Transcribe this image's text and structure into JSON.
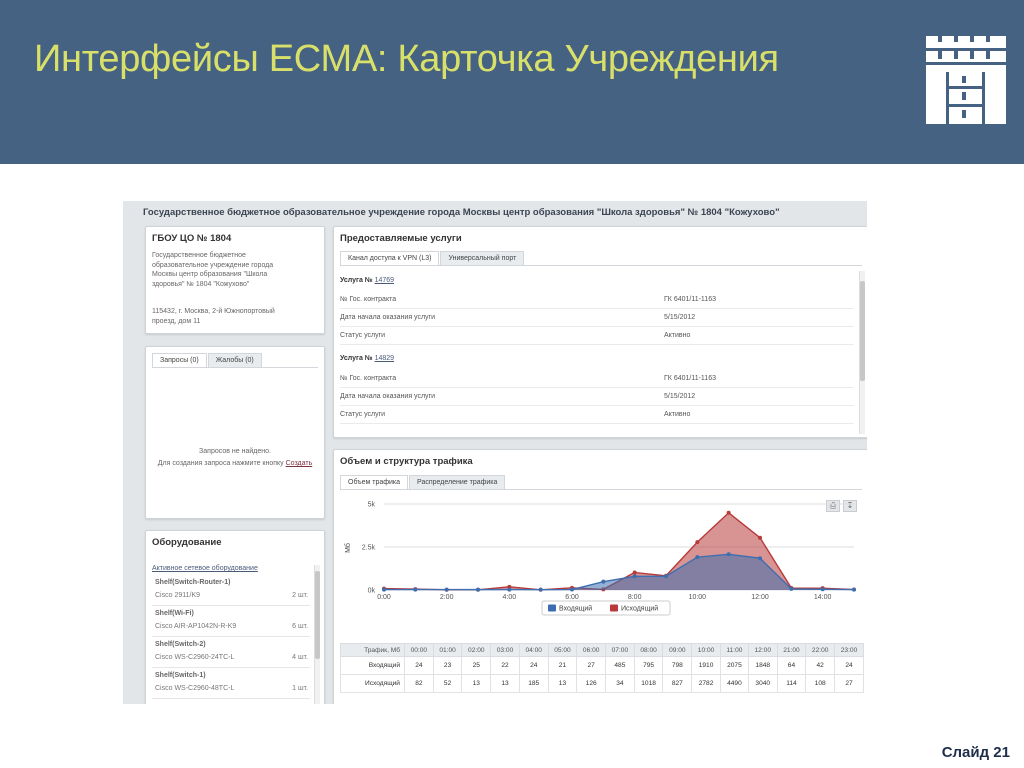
{
  "slide": {
    "title": "Интерфейсы ЕСМА: Карточка Учреждения",
    "number": "Слайд 21"
  },
  "colors": {
    "header_bg": "#466283",
    "title_color": "#d9e06a",
    "incoming": "#3d6fb0",
    "outgoing": "#b83a3a"
  },
  "screen": {
    "title": "Государственное бюджетное образовательное учреждение города Москвы центр образования \"Школа здоровья\" № 1804 \"Кожухово\""
  },
  "org": {
    "short_name": "ГБОУ ЦО № 1804",
    "full_name_lines": [
      "Государственное бюджетное",
      "образовательное учреждение города",
      "Москвы центр образования \"Школа",
      "здоровья\" № 1804 \"Кожухово\""
    ],
    "address_lines": [
      "115432, г. Москва, 2-й Южнопортовый",
      "проезд, дом 11"
    ]
  },
  "requests": {
    "tabs": [
      "Запросы (0)",
      "Жалобы (0)"
    ],
    "empty_text": "Запросов не найдено.",
    "hint_text": "Для создания запроса нажмите кнопку",
    "create_link": "Создать"
  },
  "equipment": {
    "title": "Оборудование",
    "section_link": "Активное сетевое оборудование",
    "items": [
      {
        "name": "Shelf(Switch-Router-1)",
        "model": "Cisco 2911/K9",
        "count": "2 шт."
      },
      {
        "name": "Shelf(Wi-Fi)",
        "model": "Cisco AIR-AP1042N-R-K9",
        "count": "6 шт."
      },
      {
        "name": "Shelf(Switch-2)",
        "model": "Cisco WS-C2960-24TC-L",
        "count": "4 шт."
      },
      {
        "name": "Shelf(Switch-1)",
        "model": "Cisco WS-C2960-48TC-L",
        "count": "1 шт."
      }
    ]
  },
  "services": {
    "title": "Предоставляемые услуги",
    "tabs": [
      "Канал доступа к VPN (L3)",
      "Универсальный порт"
    ],
    "items": [
      {
        "label": "Услуга №",
        "id": "14769",
        "fields": [
          {
            "k": "№ Гос. контракта",
            "v": "ГК 6401/11-1163"
          },
          {
            "k": "Дата начала оказания услуги",
            "v": "5/15/2012"
          },
          {
            "k": "Статус услуги",
            "v": "Активно"
          }
        ]
      },
      {
        "label": "Услуга №",
        "id": "14829",
        "fields": [
          {
            "k": "№ Гос. контракта",
            "v": "ГК 6401/11-1163"
          },
          {
            "k": "Дата начала оказания услуги",
            "v": "5/15/2012"
          },
          {
            "k": "Статус услуги",
            "v": "Активно"
          }
        ]
      }
    ]
  },
  "traffic": {
    "title": "Объем и структура трафика",
    "tabs": [
      "Объем трафика",
      "Распределение трафика"
    ],
    "table_header_label": "Трафик, Мб",
    "hours": [
      "00:00",
      "01:00",
      "02:00",
      "03:00",
      "04:00",
      "05:00",
      "06:00",
      "07:00",
      "08:00",
      "09:00",
      "10:00",
      "11:00",
      "12:00",
      "21:00",
      "22:00",
      "23:00"
    ],
    "rows": [
      {
        "label": "Входящий",
        "values": [
          "24",
          "23",
          "25",
          "22",
          "24",
          "21",
          "27",
          "485",
          "795",
          "798",
          "1910",
          "2075",
          "1848",
          "64",
          "42",
          "24"
        ]
      },
      {
        "label": "Исходящий",
        "values": [
          "82",
          "52",
          "13",
          "13",
          "185",
          "13",
          "126",
          "34",
          "1018",
          "827",
          "2782",
          "4490",
          "3040",
          "114",
          "108",
          "27"
        ]
      }
    ]
  },
  "chart_data": {
    "type": "area",
    "title": "",
    "xlabel": "",
    "ylabel": "Мб",
    "x": [
      "00:00",
      "01:00",
      "02:00",
      "03:00",
      "04:00",
      "05:00",
      "06:00",
      "07:00",
      "08:00",
      "09:00",
      "10:00",
      "11:00",
      "12:00",
      "13:00",
      "14:00",
      "15:00"
    ],
    "x_ticks": [
      "0:00",
      "2:00",
      "4:00",
      "6:00",
      "8:00",
      "10:00",
      "12:00",
      "14:00"
    ],
    "y_ticks": [
      "0k",
      "2.5k",
      "5k"
    ],
    "ylim": [
      0,
      5000
    ],
    "grid": true,
    "legend": "bottom",
    "series": [
      {
        "name": "Входящий",
        "color": "#3d6fb0",
        "values": [
          24,
          23,
          25,
          22,
          24,
          21,
          27,
          485,
          795,
          798,
          1910,
          2075,
          1848,
          64,
          42,
          24
        ]
      },
      {
        "name": "Исходящий",
        "color": "#b83a3a",
        "values": [
          82,
          52,
          13,
          13,
          185,
          13,
          126,
          34,
          1018,
          827,
          2782,
          4490,
          3040,
          114,
          108,
          27
        ]
      }
    ]
  }
}
